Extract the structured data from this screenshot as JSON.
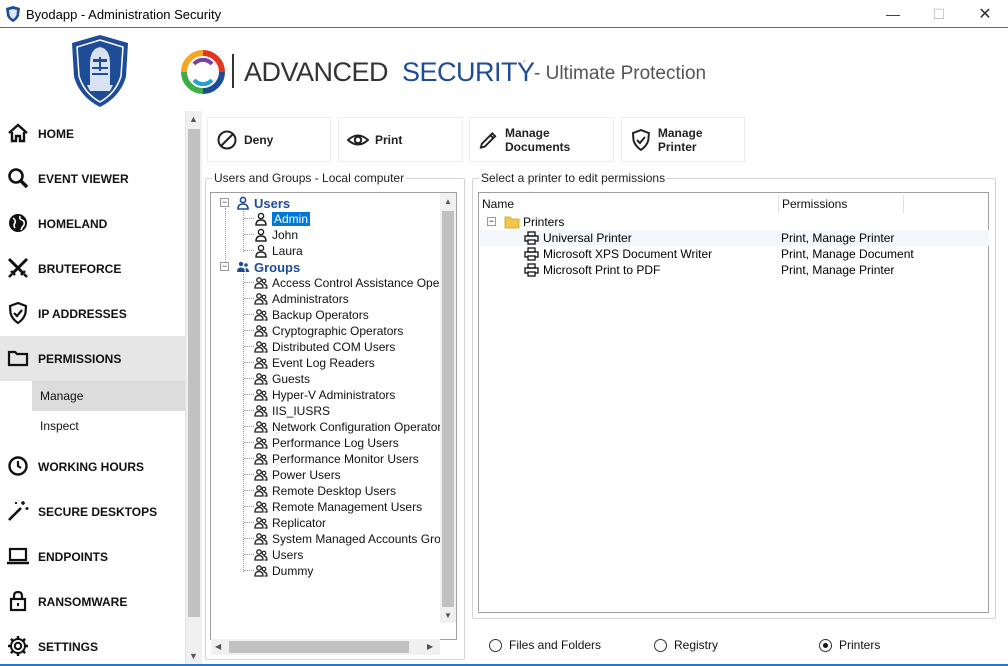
{
  "window": {
    "title": "Byodapp - Administration Security",
    "minimize_glyph": "—",
    "maximize_glyph": "☐",
    "close_glyph": "✕"
  },
  "brand": {
    "advanced": "ADVANCED",
    "security": "SECURITY",
    "tick": "´",
    "tagline": "- Ultimate Protection",
    "accent_color": "#1f4c96"
  },
  "sidebar": {
    "items": [
      {
        "label": "HOME",
        "icon": "home-icon"
      },
      {
        "label": "EVENT VIEWER",
        "icon": "search-icon"
      },
      {
        "label": "HOMELAND",
        "icon": "globe-icon"
      },
      {
        "label": "BRUTEFORCE",
        "icon": "crossed-swords-icon"
      },
      {
        "label": "IP ADDRESSES",
        "icon": "shield-check-icon"
      },
      {
        "label": "PERMISSIONS",
        "icon": "folder-icon"
      },
      {
        "label": "WORKING HOURS",
        "icon": "clock-icon"
      },
      {
        "label": "SECURE DESKTOPS",
        "icon": "magic-wand-icon"
      },
      {
        "label": "ENDPOINTS",
        "icon": "laptop-icon"
      },
      {
        "label": "RANSOMWARE",
        "icon": "lock-icon"
      },
      {
        "label": "SETTINGS",
        "icon": "gear-icon"
      }
    ],
    "sub_items": [
      "Manage",
      "Inspect"
    ]
  },
  "toolbar": {
    "deny": "Deny",
    "print": "Print",
    "manage_documents": "Manage Documents",
    "manage_printer": "Manage Printer"
  },
  "users_groups": {
    "title": "Users and Groups - Local computer",
    "users_label": "Users",
    "users": [
      "Admin",
      "John",
      "Laura"
    ],
    "selected_user": "Admin",
    "groups_label": "Groups",
    "groups": [
      "Access Control Assistance Operators",
      "Administrators",
      "Backup Operators",
      "Cryptographic Operators",
      "Distributed COM Users",
      "Event Log Readers",
      "Guests",
      "Hyper-V Administrators",
      "IIS_IUSRS",
      "Network Configuration Operators",
      "Performance Log Users",
      "Performance Monitor Users",
      "Power Users",
      "Remote Desktop Users",
      "Remote Management Users",
      "Replicator",
      "System Managed Accounts Group",
      "Users",
      "Dummy"
    ]
  },
  "printers_panel": {
    "title": "Select a printer to edit permissions",
    "columns": [
      "Name",
      "Permissions"
    ],
    "root_label": "Printers",
    "rows": [
      {
        "name": "Universal Printer",
        "permissions": "Print, Manage Printer"
      },
      {
        "name": "Microsoft XPS Document Writer",
        "permissions": "Print, Manage Document"
      },
      {
        "name": "Microsoft Print to PDF",
        "permissions": "Print, Manage Printer"
      }
    ]
  },
  "mode": {
    "options": [
      "Files and Folders",
      "Registry",
      "Printers"
    ],
    "selected": "Printers"
  }
}
